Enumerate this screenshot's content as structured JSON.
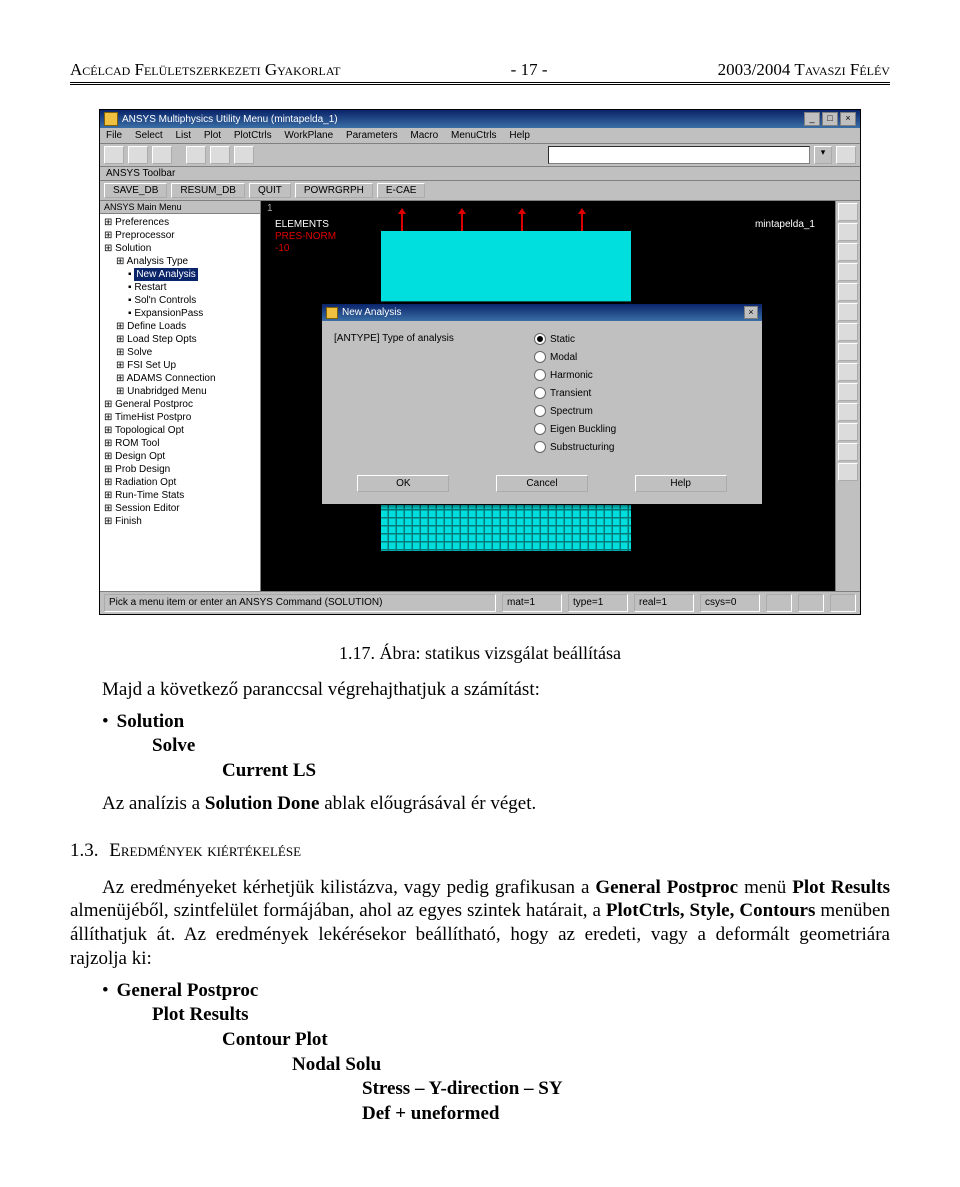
{
  "header": {
    "left": "Acélcad Felületszerkezeti Gyakorlat",
    "center": "- 17 -",
    "right": "2003/2004 Tavaszi Félév"
  },
  "ansys": {
    "windowTitle": "ANSYS Multiphysics Utility Menu (mintapelda_1)",
    "menubar": [
      "File",
      "Select",
      "List",
      "Plot",
      "PlotCtrls",
      "WorkPlane",
      "Parameters",
      "Macro",
      "MenuCtrls",
      "Help"
    ],
    "toolbarLabelLeft": "ANSYS Toolbar",
    "macroButtons": [
      "SAVE_DB",
      "RESUM_DB",
      "QUIT",
      "POWRGRPH",
      "E-CAE"
    ],
    "mainMenuTitleLeft": "ANSYS Main Menu",
    "treeItems": [
      {
        "label": "Preferences",
        "indent": 0
      },
      {
        "label": "Preprocessor",
        "indent": 0
      },
      {
        "label": "Solution",
        "indent": 0
      },
      {
        "label": "Analysis Type",
        "indent": 1
      },
      {
        "label": "New Analysis",
        "indent": 2,
        "selected": true
      },
      {
        "label": "Restart",
        "indent": 2
      },
      {
        "label": "Sol'n Controls",
        "indent": 2
      },
      {
        "label": "ExpansionPass",
        "indent": 2
      },
      {
        "label": "Define Loads",
        "indent": 1
      },
      {
        "label": "Load Step Opts",
        "indent": 1
      },
      {
        "label": "Solve",
        "indent": 1
      },
      {
        "label": "FSI Set Up",
        "indent": 1
      },
      {
        "label": "ADAMS Connection",
        "indent": 1
      },
      {
        "label": "Unabridged Menu",
        "indent": 1
      },
      {
        "label": "General Postproc",
        "indent": 0
      },
      {
        "label": "TimeHist Postpro",
        "indent": 0
      },
      {
        "label": "Topological Opt",
        "indent": 0
      },
      {
        "label": "ROM Tool",
        "indent": 0
      },
      {
        "label": "Design Opt",
        "indent": 0
      },
      {
        "label": "Prob Design",
        "indent": 0
      },
      {
        "label": "Radiation Opt",
        "indent": 0
      },
      {
        "label": "Run-Time Stats",
        "indent": 0
      },
      {
        "label": "Session Editor",
        "indent": 0
      },
      {
        "label": "Finish",
        "indent": 0
      }
    ],
    "graphics": {
      "corner": "1",
      "l1": "ELEMENTS",
      "l2": "PRES-NORM",
      "l3": "-10",
      "rightLabel": "mintapelda_1"
    },
    "dialog": {
      "title": "New Analysis",
      "label": "[ANTYPE]  Type of analysis",
      "options": [
        "Static",
        "Modal",
        "Harmonic",
        "Transient",
        "Spectrum",
        "Eigen Buckling",
        "Substructuring"
      ],
      "selectedIndex": 0,
      "buttons": [
        "OK",
        "Cancel",
        "Help"
      ]
    },
    "status": {
      "prompt": "Pick a menu item or enter an ANSYS Command (SOLUTION)",
      "cells": [
        "mat=1",
        "type=1",
        "real=1",
        "csys=0"
      ]
    }
  },
  "caption": "1.17. Ábra: statikus vizsgálat beállítása",
  "para1": "Majd a következő paranccsal végrehajthatjuk a számítást:",
  "list1": {
    "a": "Solution",
    "b": "Solve",
    "c": "Current LS"
  },
  "para2_pre": "Az analízis a ",
  "para2_bold": "Solution Done",
  "para2_post": " ablak előugrásával ér véget.",
  "section": {
    "num": "1.3.",
    "title": "Eredmények kiértékelése"
  },
  "para3_a": "Az eredményeket kérhetjük kilistázva, vagy pedig grafikusan a ",
  "para3_b": "General Postproc",
  "para3_c": " menü ",
  "para3_d": "Plot Results",
  "para3_e": " almenüjéből, szintfelület formájában, ahol az egyes szintek határait, a ",
  "para3_f": "PlotCtrls, Style, Contours",
  "para3_g": " menüben állíthatjuk át. Az eredmények lekérésekor beállítható, hogy az eredeti, vagy a deformált geometriára rajzolja ki:",
  "list2": {
    "a": "General Postproc",
    "b": "Plot Results",
    "c": "Contour Plot",
    "d": "Nodal Solu",
    "e": "Stress – Y-direction – SY",
    "f": "Def + uneformed"
  }
}
